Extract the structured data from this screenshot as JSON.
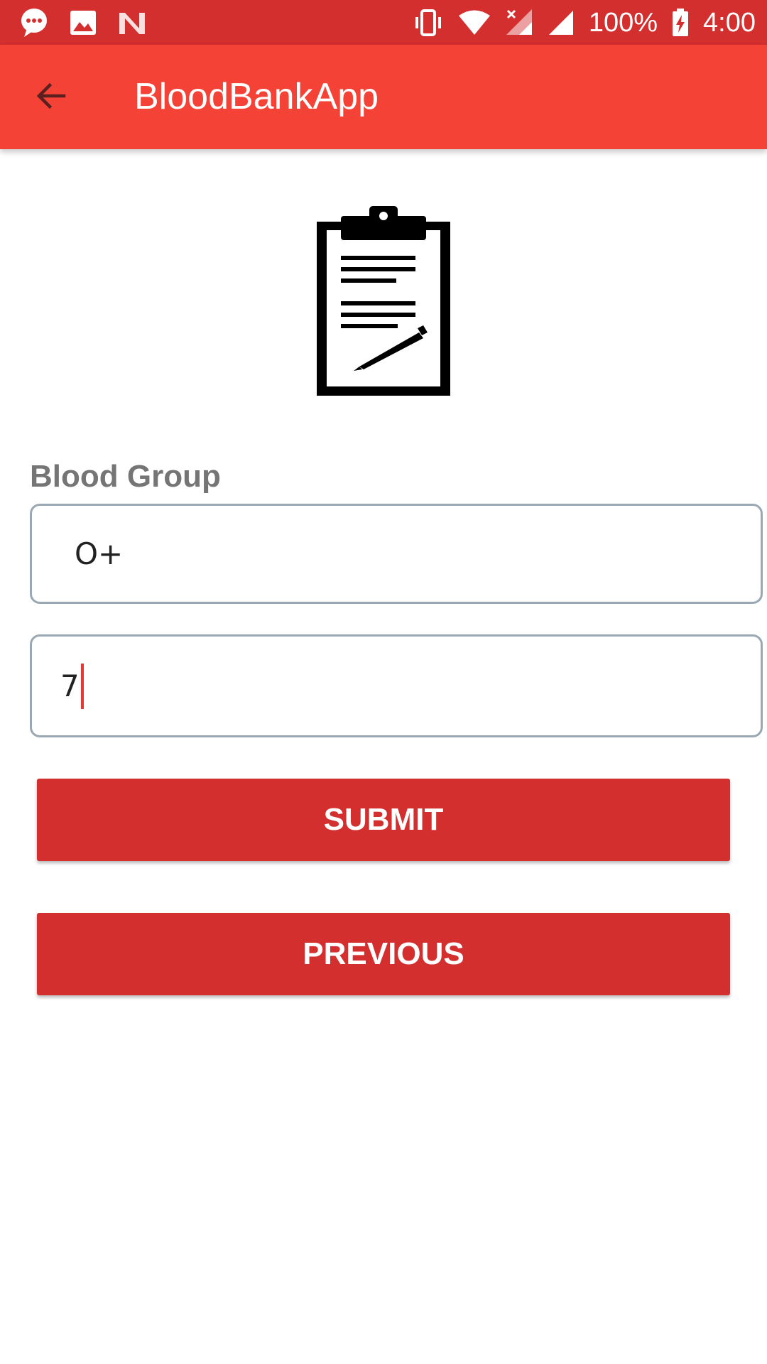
{
  "status_bar": {
    "battery_percent": "100%",
    "time": "4:00",
    "icons": [
      "messaging-icon",
      "image-icon",
      "n-logo-icon",
      "vibrate-icon",
      "wifi-icon",
      "no-sim-signal-icon",
      "cell-signal-icon",
      "battery-charging-icon"
    ]
  },
  "app_bar": {
    "title": "BloodBankApp",
    "back_icon": "arrow-back-icon"
  },
  "form": {
    "header_icon": "clipboard-icon",
    "blood_group_label": "Blood Group",
    "blood_group_value": "O+",
    "units_value": "7"
  },
  "buttons": {
    "submit_label": "SUBMIT",
    "previous_label": "PREVIOUS"
  },
  "colors": {
    "status_bar": "#d32f2f",
    "app_bar": "#f44336",
    "button": "#d32f2f",
    "label": "#757575",
    "input_border": "#9aa8b4"
  }
}
